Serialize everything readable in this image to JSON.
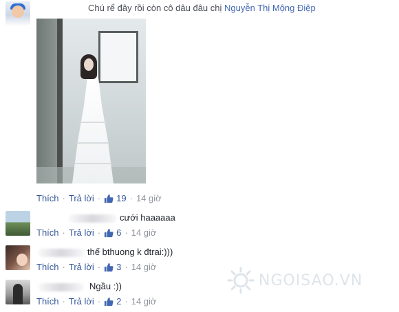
{
  "post": {
    "text": "Chú rể đây rồi còn cô dâu đâu chị ",
    "mention": "Nguyễn Thị Mộng Điệp",
    "actions": {
      "like_label": "Thích",
      "reply_label": "Trả lời",
      "separator": "·",
      "like_count": "19",
      "time": "14 giờ"
    }
  },
  "comments": [
    {
      "text": "cưới haaaaaa",
      "actions": {
        "like_label": "Thích",
        "reply_label": "Trả lời",
        "separator": "·",
        "like_count": "6",
        "time": "14 giờ"
      }
    },
    {
      "text": "thế bthuong k đtrai:)))",
      "actions": {
        "like_label": "Thích",
        "reply_label": "Trả lời",
        "separator": "·",
        "like_count": "3",
        "time": "14 giờ"
      }
    },
    {
      "text": "Ngầu :))",
      "actions": {
        "like_label": "Thích",
        "reply_label": "Trả lời",
        "separator": "·",
        "like_count": "2",
        "time": "14 giờ"
      }
    }
  ],
  "watermark": {
    "text": "NGOISAO.VN"
  },
  "icons": {
    "like": "thumbs-up-icon",
    "watermark_logo": "sun-logo-icon"
  },
  "colors": {
    "link": "#365899",
    "mention": "#4267b2",
    "meta": "#90949c",
    "text": "#1d2129"
  }
}
